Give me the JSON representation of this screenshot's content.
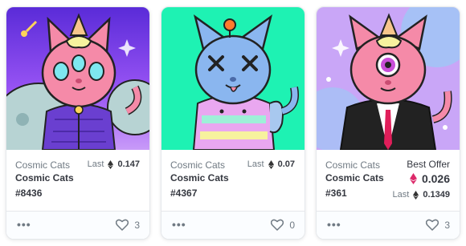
{
  "cards": [
    {
      "collection": "Cosmic Cats",
      "name": "Cosmic Cats",
      "token": "#8436",
      "price_label": "Last",
      "price": "0.147",
      "favorites": "3",
      "background": "#8a4df7"
    },
    {
      "collection": "Cosmic Cats",
      "name": "Cosmic Cats",
      "token": "#4367",
      "price_label": "Last",
      "price": "0.07",
      "favorites": "0",
      "background": "#1ef2b3"
    },
    {
      "collection": "Cosmic Cats",
      "name": "Cosmic Cats",
      "token": "#361",
      "offer_label": "Best Offer",
      "offer_price": "0.026",
      "price_label": "Last",
      "price": "0.1349",
      "favorites": "3",
      "background": "#c9a6f7"
    }
  ],
  "icons": {
    "more": "more-options-icon",
    "favorite": "heart-icon",
    "currency": "ethereum-icon",
    "offer_currency": "weth-icon"
  }
}
